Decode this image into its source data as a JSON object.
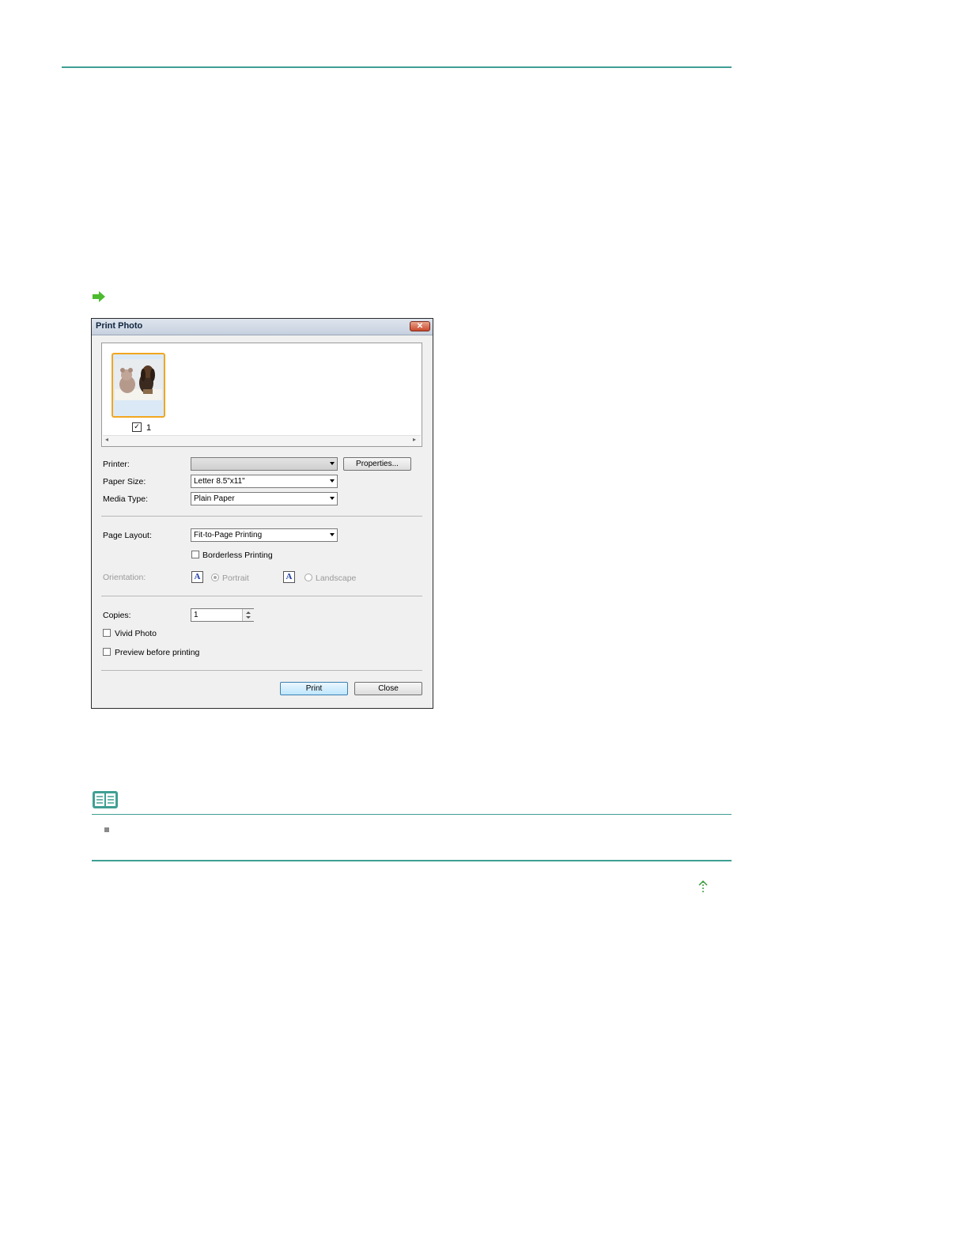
{
  "dialog": {
    "title": "Print Photo",
    "thumbnail_number": "1",
    "printer": {
      "label": "Printer:",
      "value": ""
    },
    "properties_button": "Properties...",
    "paper_size": {
      "label": "Paper Size:",
      "value": "Letter 8.5\"x11\""
    },
    "media_type": {
      "label": "Media Type:",
      "value": "Plain Paper"
    },
    "page_layout": {
      "label": "Page Layout:",
      "value": "Fit-to-Page Printing"
    },
    "borderless_printing": "Borderless Printing",
    "orientation": {
      "label": "Orientation:",
      "portrait": "Portrait",
      "landscape": "Landscape",
      "icon_letter": "A"
    },
    "copies": {
      "label": "Copies:",
      "value": "1"
    },
    "vivid_photo": "Vivid Photo",
    "preview_before_printing": "Preview before printing",
    "print_button": "Print",
    "close_button": "Close"
  },
  "colors": {
    "accent_rule": "#3f9f93",
    "arrow_green": "#4cbb2e",
    "thumbnail_border": "#f2a620"
  }
}
